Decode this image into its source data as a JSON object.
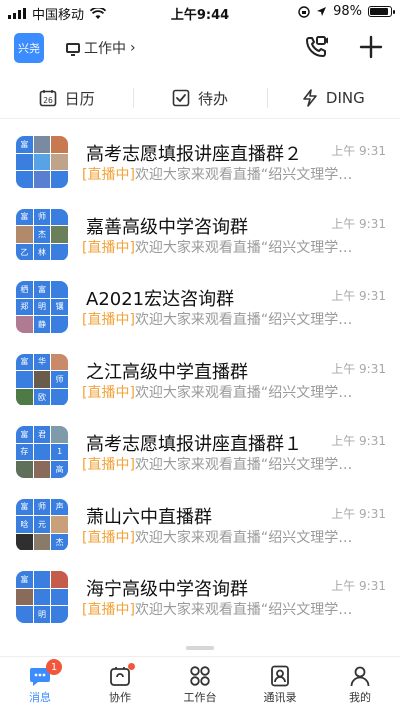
{
  "status_bar": {
    "carrier": "中国移动",
    "time": "上午9:44",
    "battery": "98%"
  },
  "header": {
    "org_badge": "兴尧",
    "status": "工作中",
    "status_chevron": "›"
  },
  "quick_actions": [
    {
      "label": "日历",
      "icon": "calendar-icon",
      "icon_text": "26"
    },
    {
      "label": "待办",
      "icon": "todo-icon"
    },
    {
      "label": "DING",
      "icon": "ding-icon"
    }
  ],
  "conversations": [
    {
      "name": "高考志愿填报讲座直播群２",
      "time": "上午 9:31",
      "tag": "[直播中]",
      "message": "欢迎大家来观看直播“绍兴文理学…",
      "avatar_cells": [
        [
          "富",
          "#3a7fe0"
        ],
        [
          "",
          "#7a8aa0"
        ],
        [
          "",
          "#c9794f"
        ],
        [
          "",
          "#3a7fe0"
        ],
        [
          "",
          "#57a3e6"
        ],
        [
          "",
          "#c0a48a"
        ],
        [
          "",
          "#3a7fe0"
        ],
        [
          "",
          "#5b7fd0"
        ],
        [
          "",
          "#3a7fe0"
        ]
      ]
    },
    {
      "name": "嘉善高级中学咨询群",
      "time": "上午 9:31",
      "tag": "[直播中]",
      "message": "欢迎大家来观看直播“绍兴文理学…",
      "avatar_cells": [
        [
          "富",
          "#3a7fe0"
        ],
        [
          "师",
          "#3a7fe0"
        ],
        [
          "",
          "#3a7fe0"
        ],
        [
          "",
          "#b3896b"
        ],
        [
          "杰",
          "#3a7fe0"
        ],
        [
          "",
          "#6a7f5a"
        ],
        [
          "乙",
          "#3a7fe0"
        ],
        [
          "林",
          "#3a7fe0"
        ],
        [
          "",
          "#3a7fe0"
        ]
      ]
    },
    {
      "name": "A2021宏达咨询群",
      "time": "上午 9:31",
      "tag": "[直播中]",
      "message": "欢迎大家来观看直播“绍兴文理学…",
      "avatar_cells": [
        [
          "栖",
          "#3a7fe0"
        ],
        [
          "富",
          "#3a7fe0"
        ],
        [
          "",
          "#3a7fe0"
        ],
        [
          "郑",
          "#3a7fe0"
        ],
        [
          "明",
          "#3a7fe0"
        ],
        [
          "镶",
          "#3a7fe0"
        ],
        [
          "",
          "#b07a92"
        ],
        [
          "静",
          "#3a7fe0"
        ],
        [
          "",
          "#3a7fe0"
        ]
      ]
    },
    {
      "name": "之江高级中学直播群",
      "time": "上午 9:31",
      "tag": "[直播中]",
      "message": "欢迎大家来观看直播“绍兴文理学…",
      "avatar_cells": [
        [
          "富",
          "#3a7fe0"
        ],
        [
          "华",
          "#3a7fe0"
        ],
        [
          "",
          "#c98a6a"
        ],
        [
          "",
          "#3a7fe0"
        ],
        [
          "",
          "#6b5b4b"
        ],
        [
          "师",
          "#3a7fe0"
        ],
        [
          "",
          "#4e7a45"
        ],
        [
          "欧",
          "#3a7fe0"
        ],
        [
          "",
          "#3a7fe0"
        ]
      ]
    },
    {
      "name": "高考志愿填报讲座直播群１",
      "time": "上午 9:31",
      "tag": "[直播中]",
      "message": "欢迎大家来观看直播“绍兴文理学…",
      "avatar_cells": [
        [
          "富",
          "#3a7fe0"
        ],
        [
          "君",
          "#3a7fe0"
        ],
        [
          "",
          "#7f9aa8"
        ],
        [
          "存",
          "#3a7fe0"
        ],
        [
          "",
          "#3a7fe0"
        ],
        [
          "1",
          "#3a7fe0"
        ],
        [
          "",
          "#5f6f5a"
        ],
        [
          "",
          "#8a6a5a"
        ],
        [
          "高",
          "#3a7fe0"
        ]
      ]
    },
    {
      "name": "萧山六中直播群",
      "time": "上午 9:31",
      "tag": "[直播中]",
      "message": "欢迎大家来观看直播“绍兴文理学…",
      "avatar_cells": [
        [
          "富",
          "#3a7fe0"
        ],
        [
          "师",
          "#3a7fe0"
        ],
        [
          "声",
          "#3a7fe0"
        ],
        [
          "晗",
          "#3a7fe0"
        ],
        [
          "元",
          "#3a7fe0"
        ],
        [
          "",
          "#c9a07a"
        ],
        [
          "",
          "#2f2f2f"
        ],
        [
          "",
          "#8a7a6a"
        ],
        [
          "杰",
          "#3a7fe0"
        ]
      ]
    },
    {
      "name": "海宁高级中学咨询群",
      "time": "上午 9:31",
      "tag": "[直播中]",
      "message": "欢迎大家来观看直播“绍兴文理学…",
      "avatar_cells": [
        [
          "富",
          "#3a7fe0"
        ],
        [
          "",
          "#3a7fe0"
        ],
        [
          "",
          "#c45b4b"
        ],
        [
          "",
          "#8a6a5a"
        ],
        [
          "",
          "#3a7fe0"
        ],
        [
          "",
          "#3a7fe0"
        ],
        [
          "",
          "#3a7fe0"
        ],
        [
          "明",
          "#3a7fe0"
        ],
        [
          "",
          "#3a7fe0"
        ]
      ]
    }
  ],
  "tab_bar": [
    {
      "label": "消息",
      "icon": "message-icon",
      "badge": "1",
      "active": true
    },
    {
      "label": "协作",
      "icon": "collaboration-icon",
      "dot": true
    },
    {
      "label": "工作台",
      "icon": "workbench-icon"
    },
    {
      "label": "通讯录",
      "icon": "contacts-icon"
    },
    {
      "label": "我的",
      "icon": "profile-icon"
    }
  ],
  "colors": {
    "accent": "#3b8cff",
    "live_tag": "#f2a33a",
    "badge": "#f2573b"
  }
}
